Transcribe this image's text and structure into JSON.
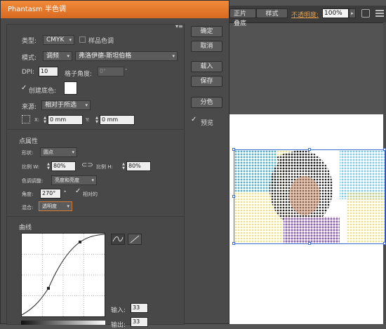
{
  "app": {
    "toolbar": {
      "blend_select": "正片叠底",
      "style_label": "样式",
      "opacity_label": "不透明度:",
      "opacity_value": "100%"
    }
  },
  "dialog": {
    "title": "Phantasm 半色调",
    "menu_icon": "menu-lines-icon",
    "type": {
      "label": "类型:",
      "value": "CMYK",
      "spot_color_label": "样品色调",
      "spot_color_checked": false
    },
    "mode": {
      "label": "模式:",
      "value": "调频",
      "dither_value": "弗洛伊德-斯坦伯格"
    },
    "dpi": {
      "label": "DPI:",
      "value": "10",
      "grid_angle_label": "格子角度:",
      "grid_angle_value": "0°"
    },
    "create_bg": {
      "label": "创建底色:",
      "checked": true,
      "color": "#ffffff"
    },
    "source": {
      "label": "来源:",
      "value": "相对于所选"
    },
    "position": {
      "x_label": "X:",
      "x_value": "0 mm",
      "y_label": "Y:",
      "y_value": "0 mm"
    },
    "dot_section": {
      "title": "点属性",
      "shape_label": "形状:",
      "shape_value": "圆点",
      "ratio_w_label": "比例 W:",
      "ratio_w_value": "80%",
      "ratio_h_label": "比例 H:",
      "ratio_h_value": "80%",
      "tone_label": "色调调整:",
      "tone_value": "亮度和亮度",
      "angle_label": "角度:",
      "angle_value": "270°",
      "relative_label": "相对的",
      "relative_checked": true,
      "blend_label": "混合:",
      "blend_value": "透明度"
    },
    "curve_section": {
      "title": "曲线",
      "input_label": "输入:",
      "input_value": "33",
      "output_label": "输出:",
      "output_value": "33"
    },
    "buttons": {
      "ok": "确定",
      "cancel": "取消",
      "load": "载入",
      "save": "保存",
      "separate": "分色",
      "preview_label": "预览",
      "preview_checked": true
    }
  }
}
